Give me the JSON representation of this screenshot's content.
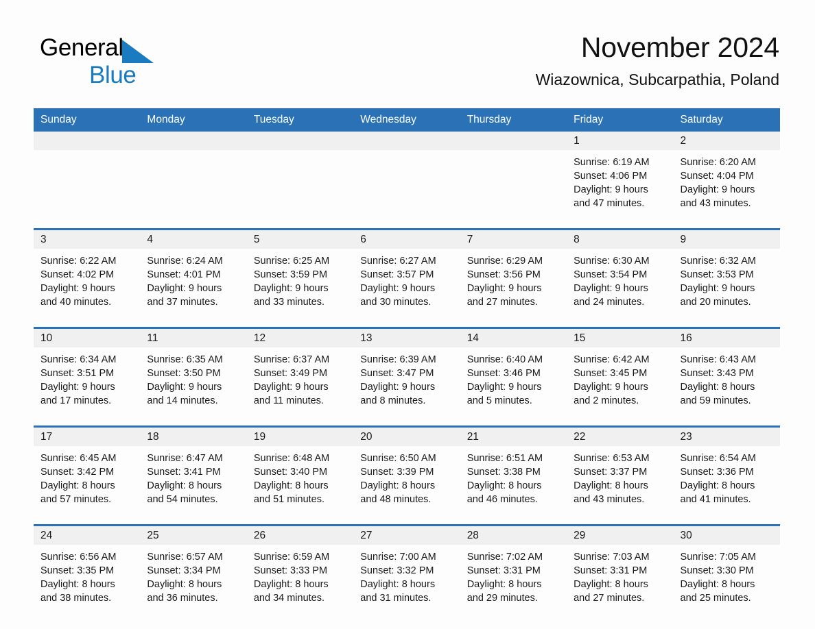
{
  "brand": {
    "name_part1": "General",
    "name_part2": "Blue",
    "flag_icon": "blue-triangle-flag-icon",
    "accent_color": "#1a7bc0"
  },
  "header": {
    "month_title": "November 2024",
    "location": "Wiazownica, Subcarpathia, Poland"
  },
  "theme": {
    "header_blue": "#2b71b5",
    "date_band_gray": "#f0f0f0",
    "page_background": "#fdfdfd"
  },
  "calendar": {
    "weekdays": [
      "Sunday",
      "Monday",
      "Tuesday",
      "Wednesday",
      "Thursday",
      "Friday",
      "Saturday"
    ],
    "weeks": [
      {
        "dates": [
          "",
          "",
          "",
          "",
          "",
          "1",
          "2"
        ],
        "cells": [
          {
            "date": "",
            "sunrise": "",
            "sunset": "",
            "daylight1": "",
            "daylight2": ""
          },
          {
            "date": "",
            "sunrise": "",
            "sunset": "",
            "daylight1": "",
            "daylight2": ""
          },
          {
            "date": "",
            "sunrise": "",
            "sunset": "",
            "daylight1": "",
            "daylight2": ""
          },
          {
            "date": "",
            "sunrise": "",
            "sunset": "",
            "daylight1": "",
            "daylight2": ""
          },
          {
            "date": "",
            "sunrise": "",
            "sunset": "",
            "daylight1": "",
            "daylight2": ""
          },
          {
            "date": "1",
            "sunrise": "Sunrise: 6:19 AM",
            "sunset": "Sunset: 4:06 PM",
            "daylight1": "Daylight: 9 hours",
            "daylight2": "and 47 minutes."
          },
          {
            "date": "2",
            "sunrise": "Sunrise: 6:20 AM",
            "sunset": "Sunset: 4:04 PM",
            "daylight1": "Daylight: 9 hours",
            "daylight2": "and 43 minutes."
          }
        ]
      },
      {
        "dates": [
          "3",
          "4",
          "5",
          "6",
          "7",
          "8",
          "9"
        ],
        "cells": [
          {
            "date": "3",
            "sunrise": "Sunrise: 6:22 AM",
            "sunset": "Sunset: 4:02 PM",
            "daylight1": "Daylight: 9 hours",
            "daylight2": "and 40 minutes."
          },
          {
            "date": "4",
            "sunrise": "Sunrise: 6:24 AM",
            "sunset": "Sunset: 4:01 PM",
            "daylight1": "Daylight: 9 hours",
            "daylight2": "and 37 minutes."
          },
          {
            "date": "5",
            "sunrise": "Sunrise: 6:25 AM",
            "sunset": "Sunset: 3:59 PM",
            "daylight1": "Daylight: 9 hours",
            "daylight2": "and 33 minutes."
          },
          {
            "date": "6",
            "sunrise": "Sunrise: 6:27 AM",
            "sunset": "Sunset: 3:57 PM",
            "daylight1": "Daylight: 9 hours",
            "daylight2": "and 30 minutes."
          },
          {
            "date": "7",
            "sunrise": "Sunrise: 6:29 AM",
            "sunset": "Sunset: 3:56 PM",
            "daylight1": "Daylight: 9 hours",
            "daylight2": "and 27 minutes."
          },
          {
            "date": "8",
            "sunrise": "Sunrise: 6:30 AM",
            "sunset": "Sunset: 3:54 PM",
            "daylight1": "Daylight: 9 hours",
            "daylight2": "and 24 minutes."
          },
          {
            "date": "9",
            "sunrise": "Sunrise: 6:32 AM",
            "sunset": "Sunset: 3:53 PM",
            "daylight1": "Daylight: 9 hours",
            "daylight2": "and 20 minutes."
          }
        ]
      },
      {
        "dates": [
          "10",
          "11",
          "12",
          "13",
          "14",
          "15",
          "16"
        ],
        "cells": [
          {
            "date": "10",
            "sunrise": "Sunrise: 6:34 AM",
            "sunset": "Sunset: 3:51 PM",
            "daylight1": "Daylight: 9 hours",
            "daylight2": "and 17 minutes."
          },
          {
            "date": "11",
            "sunrise": "Sunrise: 6:35 AM",
            "sunset": "Sunset: 3:50 PM",
            "daylight1": "Daylight: 9 hours",
            "daylight2": "and 14 minutes."
          },
          {
            "date": "12",
            "sunrise": "Sunrise: 6:37 AM",
            "sunset": "Sunset: 3:49 PM",
            "daylight1": "Daylight: 9 hours",
            "daylight2": "and 11 minutes."
          },
          {
            "date": "13",
            "sunrise": "Sunrise: 6:39 AM",
            "sunset": "Sunset: 3:47 PM",
            "daylight1": "Daylight: 9 hours",
            "daylight2": "and 8 minutes."
          },
          {
            "date": "14",
            "sunrise": "Sunrise: 6:40 AM",
            "sunset": "Sunset: 3:46 PM",
            "daylight1": "Daylight: 9 hours",
            "daylight2": "and 5 minutes."
          },
          {
            "date": "15",
            "sunrise": "Sunrise: 6:42 AM",
            "sunset": "Sunset: 3:45 PM",
            "daylight1": "Daylight: 9 hours",
            "daylight2": "and 2 minutes."
          },
          {
            "date": "16",
            "sunrise": "Sunrise: 6:43 AM",
            "sunset": "Sunset: 3:43 PM",
            "daylight1": "Daylight: 8 hours",
            "daylight2": "and 59 minutes."
          }
        ]
      },
      {
        "dates": [
          "17",
          "18",
          "19",
          "20",
          "21",
          "22",
          "23"
        ],
        "cells": [
          {
            "date": "17",
            "sunrise": "Sunrise: 6:45 AM",
            "sunset": "Sunset: 3:42 PM",
            "daylight1": "Daylight: 8 hours",
            "daylight2": "and 57 minutes."
          },
          {
            "date": "18",
            "sunrise": "Sunrise: 6:47 AM",
            "sunset": "Sunset: 3:41 PM",
            "daylight1": "Daylight: 8 hours",
            "daylight2": "and 54 minutes."
          },
          {
            "date": "19",
            "sunrise": "Sunrise: 6:48 AM",
            "sunset": "Sunset: 3:40 PM",
            "daylight1": "Daylight: 8 hours",
            "daylight2": "and 51 minutes."
          },
          {
            "date": "20",
            "sunrise": "Sunrise: 6:50 AM",
            "sunset": "Sunset: 3:39 PM",
            "daylight1": "Daylight: 8 hours",
            "daylight2": "and 48 minutes."
          },
          {
            "date": "21",
            "sunrise": "Sunrise: 6:51 AM",
            "sunset": "Sunset: 3:38 PM",
            "daylight1": "Daylight: 8 hours",
            "daylight2": "and 46 minutes."
          },
          {
            "date": "22",
            "sunrise": "Sunrise: 6:53 AM",
            "sunset": "Sunset: 3:37 PM",
            "daylight1": "Daylight: 8 hours",
            "daylight2": "and 43 minutes."
          },
          {
            "date": "23",
            "sunrise": "Sunrise: 6:54 AM",
            "sunset": "Sunset: 3:36 PM",
            "daylight1": "Daylight: 8 hours",
            "daylight2": "and 41 minutes."
          }
        ]
      },
      {
        "dates": [
          "24",
          "25",
          "26",
          "27",
          "28",
          "29",
          "30"
        ],
        "cells": [
          {
            "date": "24",
            "sunrise": "Sunrise: 6:56 AM",
            "sunset": "Sunset: 3:35 PM",
            "daylight1": "Daylight: 8 hours",
            "daylight2": "and 38 minutes."
          },
          {
            "date": "25",
            "sunrise": "Sunrise: 6:57 AM",
            "sunset": "Sunset: 3:34 PM",
            "daylight1": "Daylight: 8 hours",
            "daylight2": "and 36 minutes."
          },
          {
            "date": "26",
            "sunrise": "Sunrise: 6:59 AM",
            "sunset": "Sunset: 3:33 PM",
            "daylight1": "Daylight: 8 hours",
            "daylight2": "and 34 minutes."
          },
          {
            "date": "27",
            "sunrise": "Sunrise: 7:00 AM",
            "sunset": "Sunset: 3:32 PM",
            "daylight1": "Daylight: 8 hours",
            "daylight2": "and 31 minutes."
          },
          {
            "date": "28",
            "sunrise": "Sunrise: 7:02 AM",
            "sunset": "Sunset: 3:31 PM",
            "daylight1": "Daylight: 8 hours",
            "daylight2": "and 29 minutes."
          },
          {
            "date": "29",
            "sunrise": "Sunrise: 7:03 AM",
            "sunset": "Sunset: 3:31 PM",
            "daylight1": "Daylight: 8 hours",
            "daylight2": "and 27 minutes."
          },
          {
            "date": "30",
            "sunrise": "Sunrise: 7:05 AM",
            "sunset": "Sunset: 3:30 PM",
            "daylight1": "Daylight: 8 hours",
            "daylight2": "and 25 minutes."
          }
        ]
      }
    ]
  }
}
